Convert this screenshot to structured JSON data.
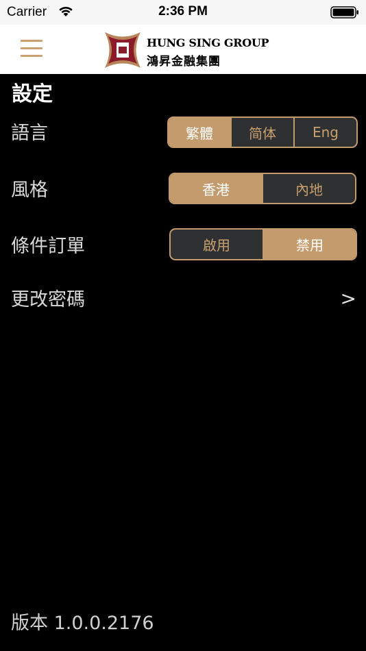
{
  "status_bar": {
    "carrier": "Carrier",
    "time": "2:36 PM"
  },
  "header": {
    "logo_en": "HUNG SING GROUP",
    "logo_zh": "鴻昇金融集團"
  },
  "page": {
    "title": "設定"
  },
  "settings": {
    "language": {
      "label": "語言",
      "options": [
        "繁體",
        "简体",
        "Eng"
      ],
      "selected": "繁體"
    },
    "style": {
      "label": "風格",
      "options": [
        "香港",
        "內地"
      ],
      "selected": "香港"
    },
    "conditional_order": {
      "label": "條件訂單",
      "options": [
        "啟用",
        "禁用"
      ],
      "selected": "禁用"
    },
    "change_password": {
      "label": "更改密碼",
      "arrow": ">"
    }
  },
  "footer": {
    "version": "版本 1.0.0.2176"
  },
  "colors": {
    "accent": "#c49b6d",
    "background": "#000000",
    "segment_bg": "#2e3032"
  }
}
